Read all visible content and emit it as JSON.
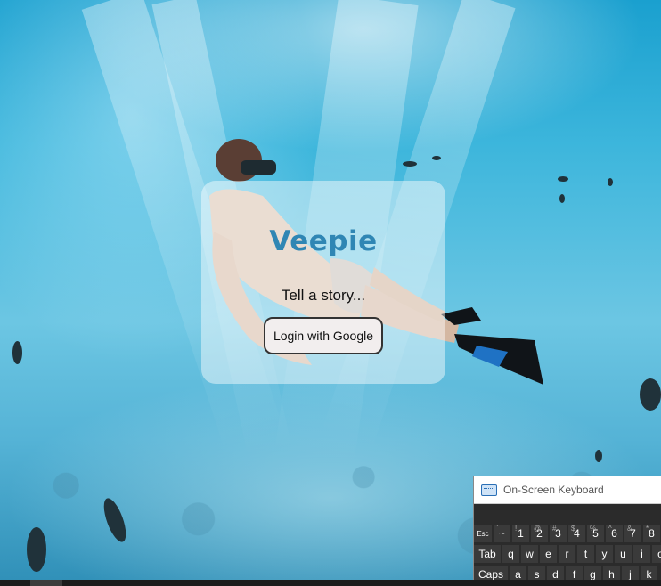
{
  "app": {
    "brand": "Veepie",
    "tagline": "Tell a story...",
    "login_button": "Login with Google"
  },
  "keyboard": {
    "title": "On-Screen Keyboard",
    "row1": [
      {
        "label": "Esc",
        "sup": ""
      },
      {
        "label": "~",
        "sup": "`"
      },
      {
        "label": "1",
        "sup": "!"
      },
      {
        "label": "2",
        "sup": "@"
      },
      {
        "label": "3",
        "sup": "#"
      },
      {
        "label": "4",
        "sup": "$"
      },
      {
        "label": "5",
        "sup": "%"
      },
      {
        "label": "6",
        "sup": "^"
      },
      {
        "label": "7",
        "sup": "&"
      },
      {
        "label": "8",
        "sup": "*"
      }
    ],
    "row2": [
      "Tab",
      "q",
      "w",
      "e",
      "r",
      "t",
      "y",
      "u",
      "i",
      "o"
    ],
    "row3": [
      "Caps",
      "a",
      "s",
      "d",
      "f",
      "g",
      "h",
      "j",
      "k"
    ]
  },
  "colors": {
    "brand": "#2f86b4",
    "card_bg": "rgba(255,255,255,0.45)",
    "button_bg": "#f2eeee",
    "keyboard_bg": "#2b2b2b"
  }
}
